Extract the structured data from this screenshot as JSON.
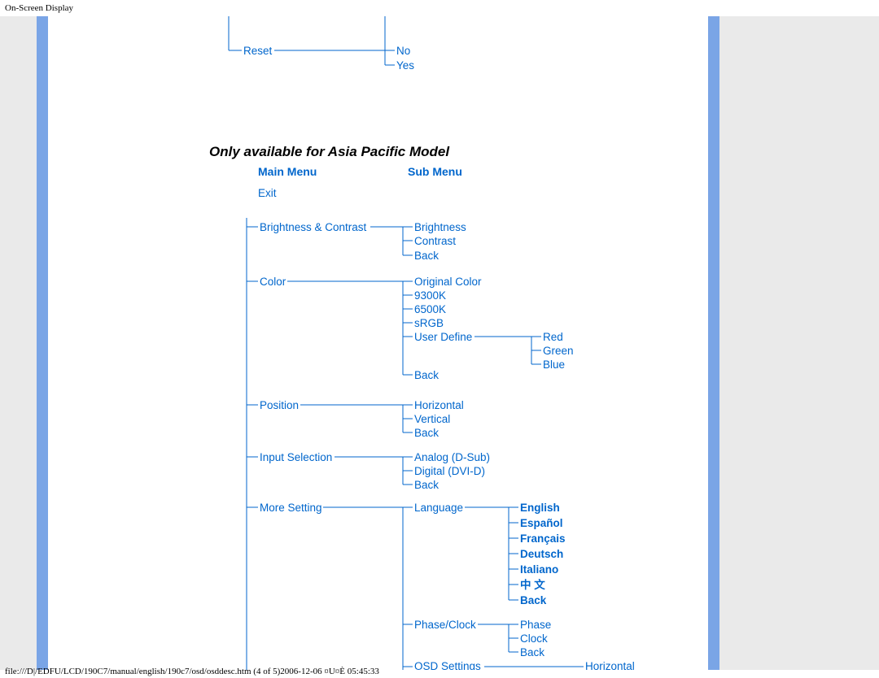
{
  "header": "On-Screen Display",
  "footer": "file:///D|/EDFU/LCD/190C7/manual/english/190c7/osd/osddesc.htm (4 of 5)2006-12-06 ¤U¤È 05:45:33",
  "tree": {
    "reset": "Reset",
    "no": "No",
    "yes": "Yes",
    "only_asia": "Only available for Asia Pacific Model",
    "main_menu": "Main Menu",
    "sub_menu": "Sub Menu",
    "exit": "Exit",
    "brightness_contrast": "Brightness & Contrast",
    "brightness": "Brightness",
    "contrast": "Contrast",
    "back": "Back",
    "color": "Color",
    "original_color": "Original Color",
    "c9300k": "9300K",
    "c6500k": "6500K",
    "srgb": "sRGB",
    "user_define": "User Define",
    "red": "Red",
    "green": "Green",
    "blue": "Blue",
    "position": "Position",
    "horizontal": "Horizontal",
    "vertical": "Vertical",
    "input_selection": "Input Selection",
    "analog": "Analog  (D-Sub)",
    "digital": "Digital   (DVI-D)",
    "more_setting": "More Setting",
    "language": "Language",
    "english": "English",
    "espanol": "Español",
    "francais": "Français",
    "deutsch": "Deutsch",
    "italiano": "Italiano",
    "chinese": "中 文",
    "phase_clock": "Phase/Clock",
    "phase": "Phase",
    "clock": "Clock",
    "osd_settings": "OSD Settings"
  }
}
